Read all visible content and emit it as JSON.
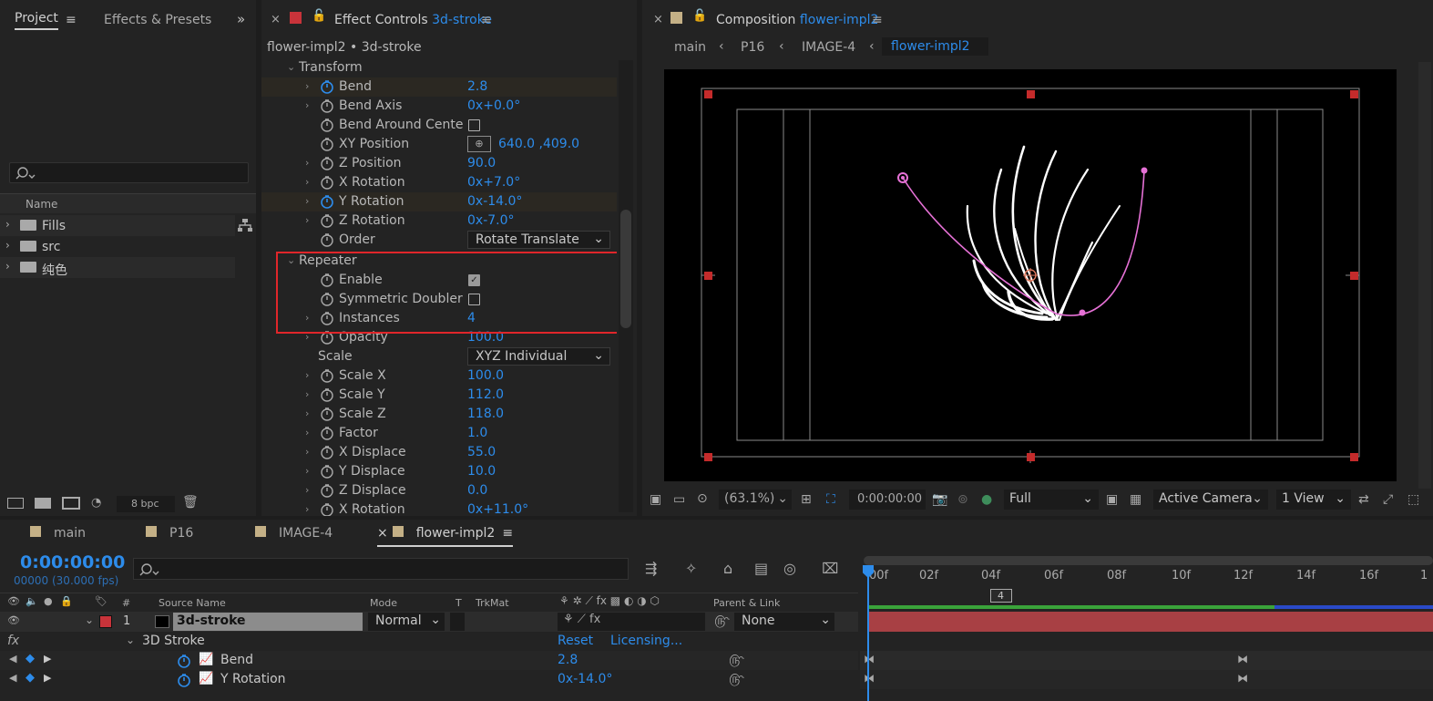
{
  "project_panel": {
    "tab_project": "Project",
    "tab_effects": "Effects & Presets",
    "search_placeholder": "",
    "col_name": "Name",
    "items": [
      {
        "name": "Fills"
      },
      {
        "name": "src"
      },
      {
        "name": "纯色"
      }
    ],
    "bpc": "8 bpc"
  },
  "effect_controls": {
    "tab_label": "Effect Controls",
    "tab_layer": "3d-stroke",
    "header": "flower-impl2 • 3d-stroke",
    "transform_group": "Transform",
    "props": [
      {
        "label": "Bend",
        "value": "2.8"
      },
      {
        "label": "Bend Axis",
        "value_prefix": "0",
        "value": "x+0.0°"
      },
      {
        "label": "Bend Around Cente"
      },
      {
        "label": "XY Position",
        "value": "640.0 ,409.0"
      },
      {
        "label": "Z Position",
        "value": "90.0"
      },
      {
        "label": "X Rotation",
        "value_prefix": "0",
        "value": "x+7.0°"
      },
      {
        "label": "Y Rotation",
        "value_prefix": "0",
        "value": "x-14.0°"
      },
      {
        "label": "Z Rotation",
        "value_prefix": "0",
        "value": "x-7.0°"
      },
      {
        "label": "Order",
        "value": "Rotate Translate"
      }
    ],
    "repeater_group": "Repeater",
    "repeater_props": [
      {
        "label": "Enable",
        "checked": true
      },
      {
        "label": "Symmetric Doubler",
        "checked": false
      },
      {
        "label": "Instances",
        "value": "4"
      }
    ],
    "more_props": [
      {
        "label": "Opacity",
        "value": "100.0"
      },
      {
        "label": "Scale",
        "value": "XYZ Individual"
      },
      {
        "label": "Scale X",
        "value": "100.0"
      },
      {
        "label": "Scale Y",
        "value": "112.0"
      },
      {
        "label": "Scale Z",
        "value": "118.0"
      },
      {
        "label": "Factor",
        "value": "1.0"
      },
      {
        "label": "X Displace",
        "value": "55.0"
      },
      {
        "label": "Y Displace",
        "value": "10.0"
      },
      {
        "label": "Z Displace",
        "value": "0.0"
      },
      {
        "label": "X Rotation",
        "value": "0x+11.0°"
      }
    ],
    "highlight_color": "#e0262a"
  },
  "composition": {
    "tab_label": "Composition",
    "tab_comp": "flower-impl2",
    "breadcrumbs": [
      "main",
      "P16",
      "IMAGE-4",
      "flower-impl2"
    ],
    "zoom": "(63.1%)",
    "timecode": "0:00:00:00",
    "resolution": "Full",
    "camera": "Active Camera",
    "views": "1 View"
  },
  "timeline": {
    "tabs": [
      "main",
      "P16",
      "IMAGE-4",
      "flower-impl2"
    ],
    "timecode": "0:00:00:00",
    "fps": "00000 (30.000 fps)",
    "columns": {
      "hash": "#",
      "source": "Source Name",
      "mode": "Mode",
      "t": "T",
      "trkmat": "TrkMat",
      "parent": "Parent & Link"
    },
    "layer": {
      "index": "1",
      "name": "3d-stroke",
      "mode": "Normal",
      "parent": "None"
    },
    "effect": {
      "name": "3D Stroke",
      "reset": "Reset",
      "licensing": "Licensing..."
    },
    "props": [
      {
        "label": "Bend",
        "value": "2.8"
      },
      {
        "label": "Y Rotation",
        "value": "0x-14.0°"
      }
    ],
    "ruler": [
      "00f",
      "02f",
      "04f",
      "06f",
      "08f",
      "10f",
      "12f",
      "14f",
      "16f",
      "1"
    ],
    "marker": "4"
  }
}
